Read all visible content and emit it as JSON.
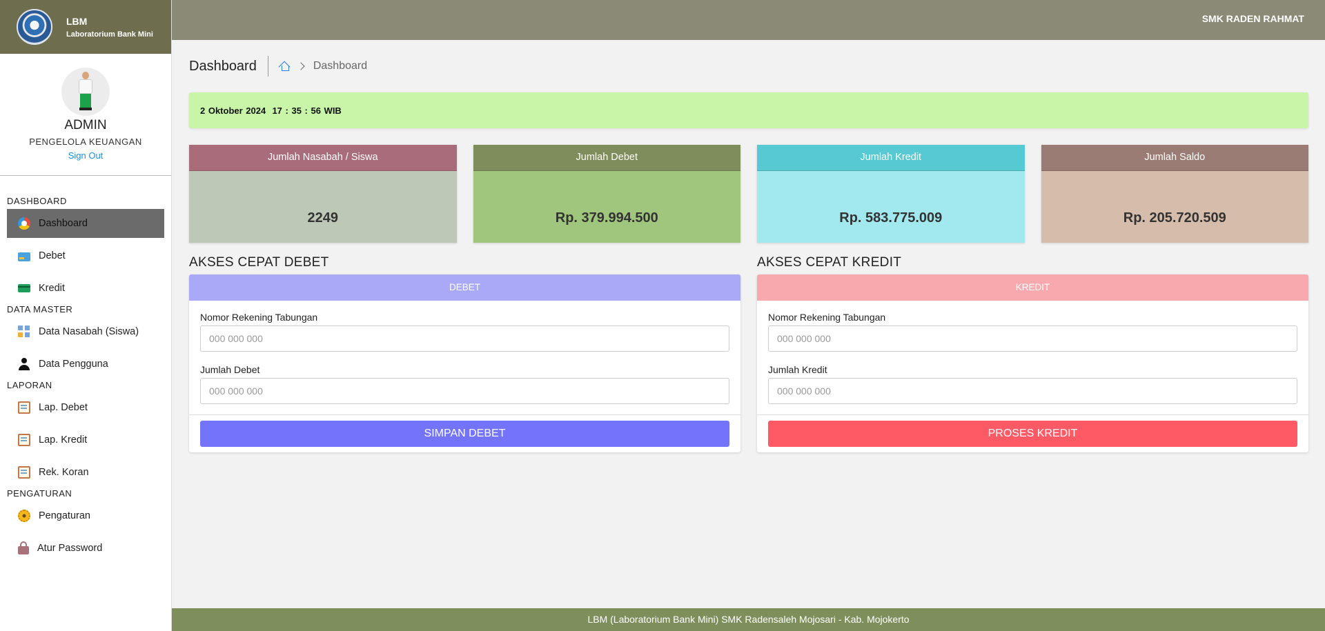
{
  "brand": {
    "title": "LBM",
    "subtitle": "Laboratorium Bank Mini"
  },
  "profile": {
    "role": "ADMIN",
    "position": "PENGELOLA KEUANGAN",
    "signout": "Sign Out"
  },
  "nav": {
    "dashboard_section": "DASHBOARD",
    "dashboard": "Dashboard",
    "debet": "Debet",
    "kredit": "Kredit",
    "master_section": "DATA MASTER",
    "data_nasabah": "Data Nasabah (Siswa)",
    "data_pengguna": "Data Pengguna",
    "laporan_section": "LAPORAN",
    "lap_debet": "Lap. Debet",
    "lap_kredit": "Lap. Kredit",
    "rek_koran": "Rek. Koran",
    "pengaturan_section": "PENGATURAN",
    "pengaturan": "Pengaturan",
    "atur_password": "Atur Password"
  },
  "topbar": {
    "school": "SMK RADEN RAHMAT"
  },
  "header": {
    "title": "Dashboard",
    "breadcrumb": "Dashboard"
  },
  "clock": {
    "date": "2 Oktober 2024",
    "time": "17 : 35 : 56 WIB"
  },
  "stats": [
    {
      "label": "Jumlah Nasabah / Siswa",
      "value": "2249",
      "head_color": "#a86c7a",
      "body_color": "#bec8b6"
    },
    {
      "label": "Jumlah Debet",
      "value": "Rp. 379.994.500",
      "head_color": "#7f8c5c",
      "body_color": "#9fc67c"
    },
    {
      "label": "Jumlah Kredit",
      "value": "Rp. 583.775.009",
      "head_color": "#56c9d2",
      "body_color": "#a2e9ef"
    },
    {
      "label": "Jumlah Saldo",
      "value": "Rp. 205.720.509",
      "head_color": "#9a7c74",
      "body_color": "#d6bcaa"
    }
  ],
  "debet_form": {
    "title": "AKSES CEPAT DEBET",
    "header": "DEBET",
    "account_label": "Nomor Rekening Tabungan",
    "account_placeholder": "000 000 000",
    "amount_label": "Jumlah Debet",
    "amount_placeholder": "000 000 000",
    "button": "SIMPAN DEBET",
    "head_color": "#a9a9f7",
    "button_color": "#7474fb"
  },
  "kredit_form": {
    "title": "AKSES CEPAT KREDIT",
    "header": "KREDIT",
    "account_label": "Nomor Rekening Tabungan",
    "account_placeholder": "000 000 000",
    "amount_label": "Jumlah Kredit",
    "amount_placeholder": "000 000 000",
    "button": "PROSES KREDIT",
    "head_color": "#f8a9ae",
    "button_color": "#fd5a65"
  },
  "footer": {
    "text": "LBM (Laboratorium Bank Mini) SMK Radensaleh Mojosari - Kab. Mojokerto"
  }
}
